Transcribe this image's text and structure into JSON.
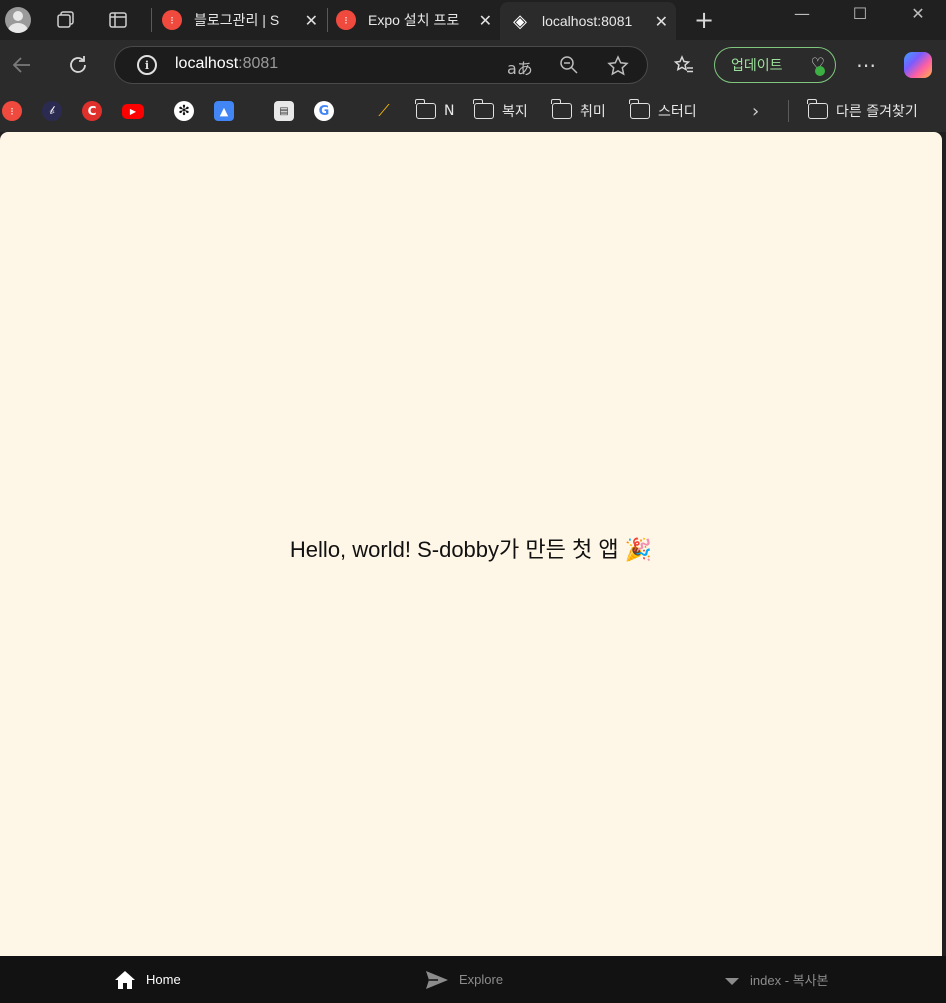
{
  "browser": {
    "tabs": [
      {
        "title": "블로그관리 | S",
        "favicon": "tistory-icon"
      },
      {
        "title": "Expo 설치 프로",
        "favicon": "tistory-icon"
      },
      {
        "title": "localhost:8081",
        "favicon": "expo-cube-icon",
        "active": true
      }
    ],
    "address": {
      "host": "localhost",
      "port": ":8081"
    },
    "update_label": "업데이트",
    "bookmarks": {
      "folders": [
        "N",
        "복지",
        "취미",
        "스터디"
      ],
      "other": "다른 즐겨찾기"
    }
  },
  "page": {
    "message": "Hello, world! S-dobby가 만든 첫 앱 🎉"
  },
  "bottom_nav": {
    "items": [
      {
        "label": "Home",
        "icon": "home-icon",
        "active": true
      },
      {
        "label": "Explore",
        "icon": "send-icon",
        "active": false
      },
      {
        "label": "index - 복사본",
        "icon": "triangle-down-icon",
        "active": false
      }
    ]
  },
  "colors": {
    "page_background": "#fef6e6",
    "chrome_background": "#202020",
    "update_accent": "#7fc77f",
    "nav_background": "#121212"
  }
}
